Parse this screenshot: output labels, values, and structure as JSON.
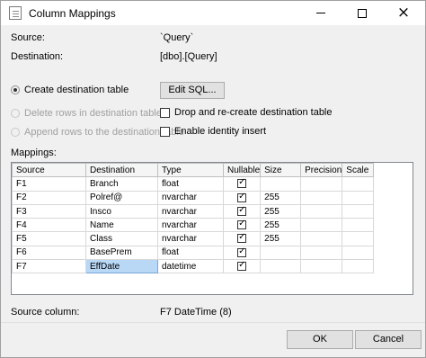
{
  "window": {
    "title": "Column Mappings",
    "minimize": "minimize",
    "maximize": "maximize",
    "close": "×"
  },
  "info": {
    "source_label": "Source:",
    "source_value": "`Query`",
    "destination_label": "Destination:",
    "destination_value": "[dbo].[Query]"
  },
  "options": {
    "create_table": "Create destination table",
    "edit_sql": "Edit SQL...",
    "delete_rows": "Delete rows in destination table",
    "append_rows": "Append rows to the destination table",
    "drop_recreate": "Drop and re-create destination table",
    "identity_insert": "Enable identity insert"
  },
  "mappings": {
    "label": "Mappings:",
    "headers": [
      "Source",
      "Destination",
      "Type",
      "Nullable",
      "Size",
      "Precision",
      "Scale"
    ],
    "rows": [
      {
        "source": "F1",
        "destination": "Branch",
        "type": "float",
        "nullable": true,
        "size": "",
        "precision": "",
        "scale": ""
      },
      {
        "source": "F2",
        "destination": "Polref@",
        "type": "nvarchar",
        "nullable": true,
        "size": "255",
        "precision": "",
        "scale": ""
      },
      {
        "source": "F3",
        "destination": "Insco",
        "type": "nvarchar",
        "nullable": true,
        "size": "255",
        "precision": "",
        "scale": ""
      },
      {
        "source": "F4",
        "destination": "Name",
        "type": "nvarchar",
        "nullable": true,
        "size": "255",
        "precision": "",
        "scale": ""
      },
      {
        "source": "F5",
        "destination": "Class",
        "type": "nvarchar",
        "nullable": true,
        "size": "255",
        "precision": "",
        "scale": ""
      },
      {
        "source": "F6",
        "destination": "BasePrem",
        "type": "float",
        "nullable": true,
        "size": "",
        "precision": "",
        "scale": ""
      },
      {
        "source": "F7",
        "destination": "EffDate",
        "type": "datetime",
        "nullable": true,
        "size": "",
        "precision": "",
        "scale": ""
      }
    ]
  },
  "details": {
    "source_column_label": "Source column:",
    "source_column_value": "F7 DateTime (8)"
  },
  "footer": {
    "ok": "OK",
    "cancel": "Cancel"
  },
  "colors": {
    "selected_cell": "#b8d8f6",
    "background": "#f0f0f0"
  }
}
